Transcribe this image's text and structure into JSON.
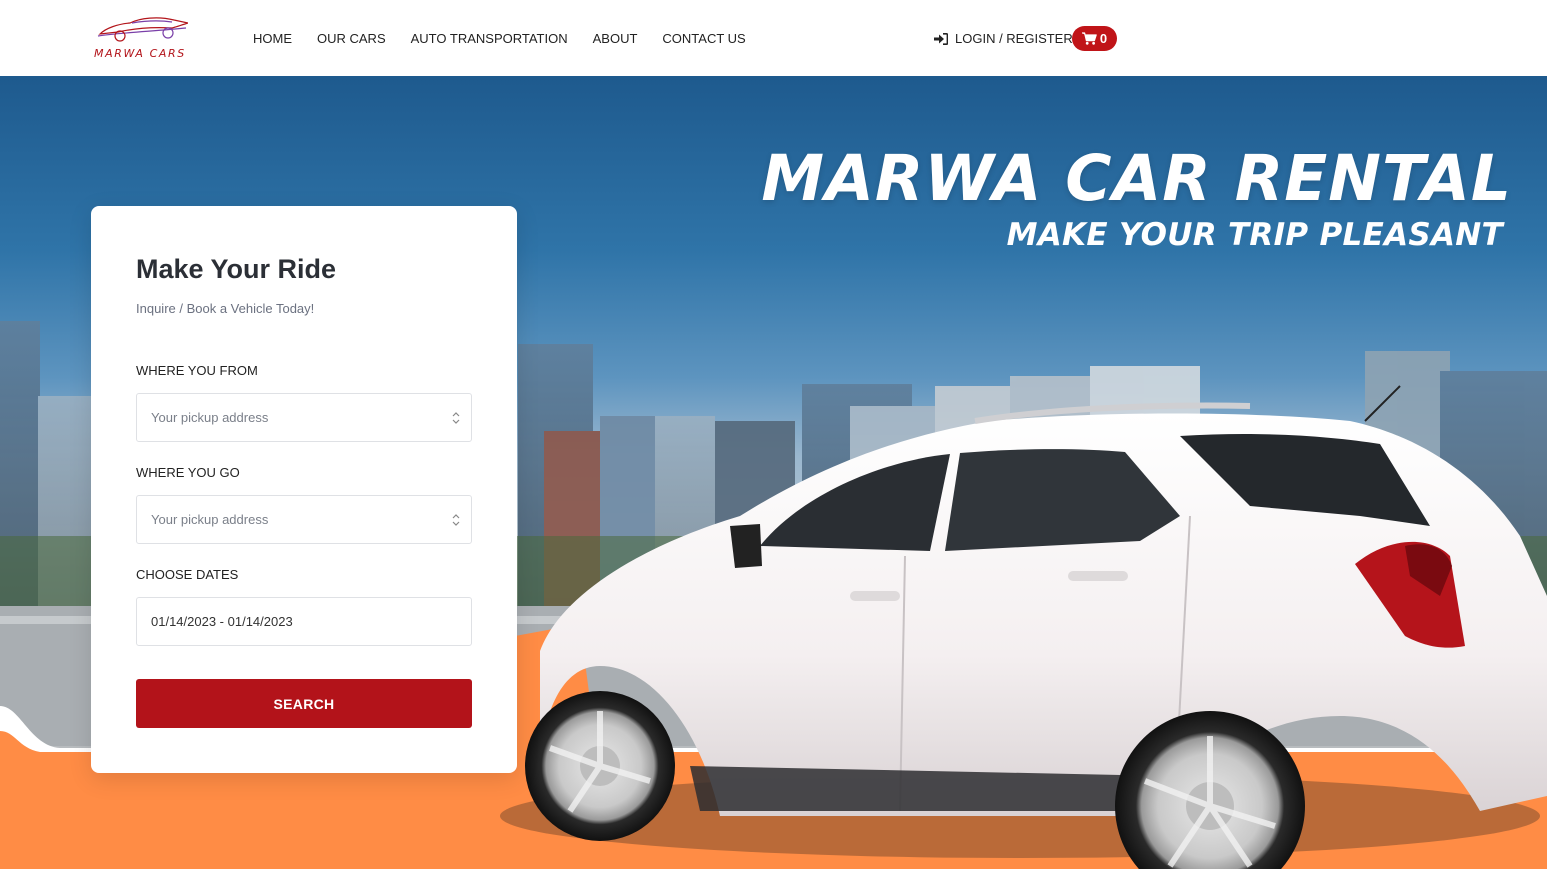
{
  "brand": {
    "logo_text": "MARWA CARS",
    "accent_color": "#b3151b"
  },
  "nav": {
    "items": [
      {
        "label": "HOME"
      },
      {
        "label": "OUR CARS"
      },
      {
        "label": "AUTO TRANSPORTATION"
      },
      {
        "label": "ABOUT"
      },
      {
        "label": "CONTACT US"
      }
    ],
    "login_label": "LOGIN / REGISTER",
    "login_icon": "sign-in-icon",
    "cart_icon": "cart-icon",
    "cart_count": "0",
    "cart_color": "#c01418"
  },
  "hero": {
    "title": "MARWA CAR RENTAL",
    "subtitle": "MAKE YOUR TRIP PLEASANT",
    "accent_orange": "#ff8c45"
  },
  "booking": {
    "title": "Make Your Ride",
    "subtitle": "Inquire / Book a Vehicle Today!",
    "from_label": "WHERE YOU FROM",
    "from_placeholder": "Your pickup address",
    "to_label": "WHERE YOU GO",
    "to_placeholder": "Your pickup address",
    "dates_label": "CHOOSE DATES",
    "dates_value": "01/14/2023 - 01/14/2023",
    "search_label": "SEARCH",
    "button_color": "#b3131a"
  }
}
